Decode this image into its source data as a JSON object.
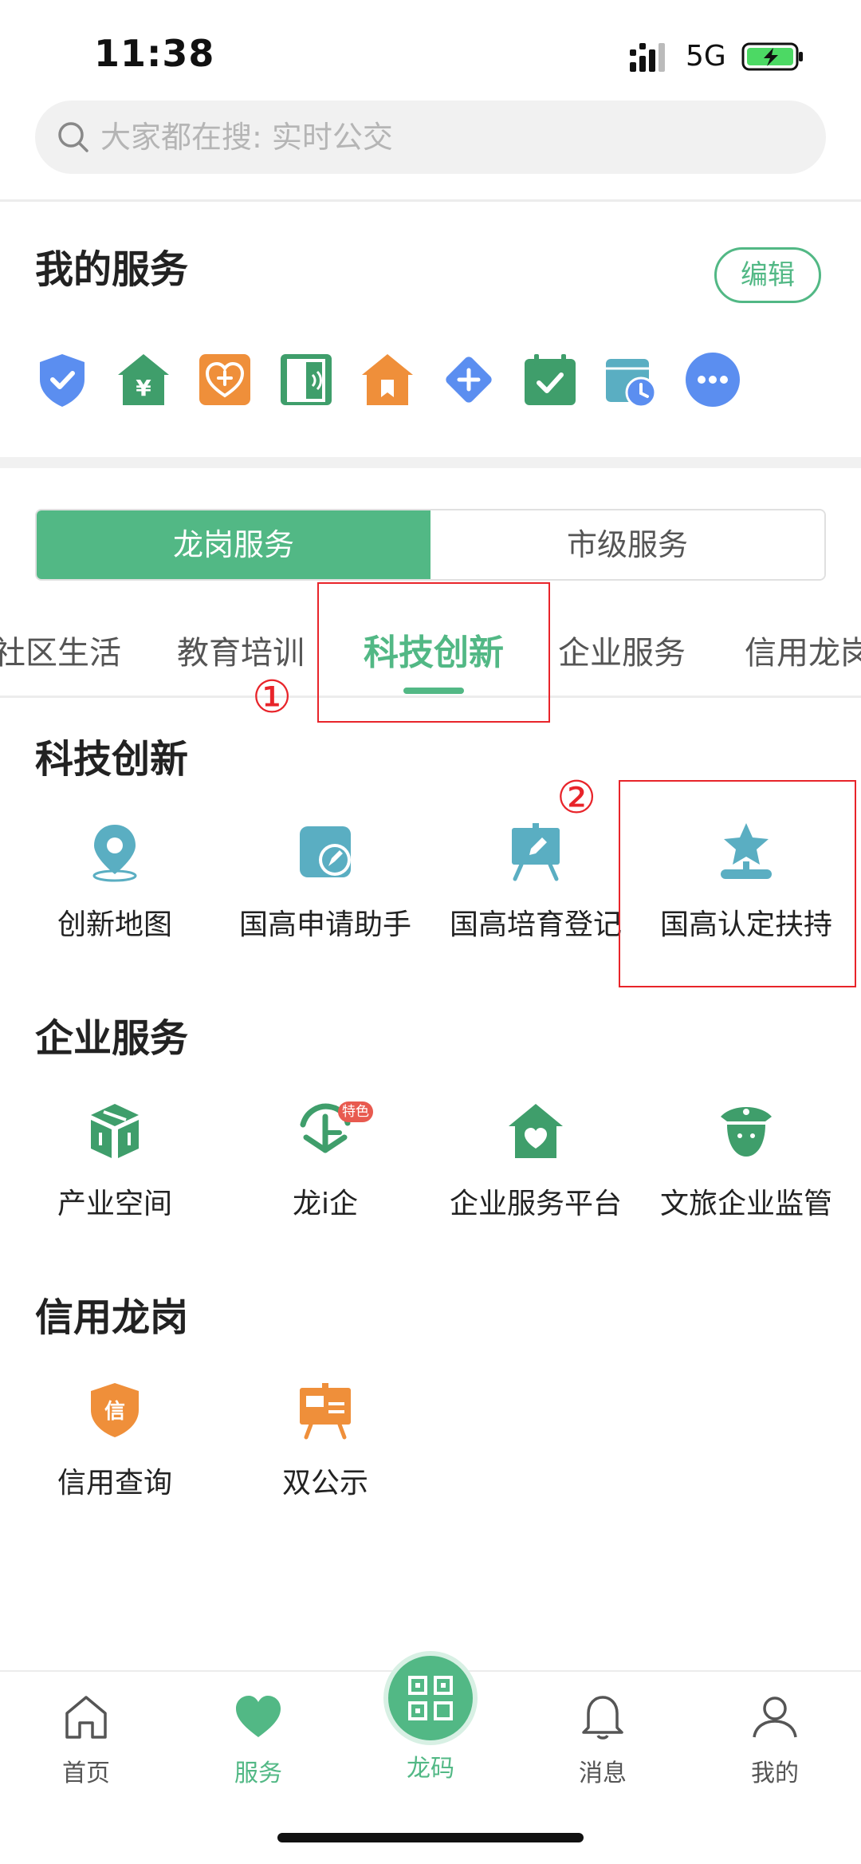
{
  "status_bar": {
    "time": "11:38",
    "network": "5G"
  },
  "search": {
    "placeholder": "大家都在搜: 实时公交"
  },
  "my_services": {
    "title": "我的服务",
    "edit_label": "编辑",
    "icons": [
      "shield-check-icon",
      "money-house-icon",
      "heart-plus-icon",
      "door-icon",
      "bookmark-house-icon",
      "diamond-plus-icon",
      "calendar-check-icon",
      "calendar-clock-icon",
      "more-icon"
    ]
  },
  "segment": {
    "active": "龙岗服务",
    "inactive": "市级服务"
  },
  "category_tabs": [
    "社区生活",
    "教育培训",
    "科技创新",
    "企业服务",
    "信用龙岗"
  ],
  "annotations": {
    "first": "①",
    "second": "②"
  },
  "sections": {
    "tech": {
      "title": "科技创新",
      "items": [
        "创新地图",
        "国高申请助手",
        "国高培育登记",
        "国高认定扶持"
      ]
    },
    "enterprise": {
      "title": "企业服务",
      "items": [
        "产业空间",
        "龙i企",
        "企业服务平台",
        "文旅企业监管"
      ],
      "badge": "特色"
    },
    "credit": {
      "title": "信用龙岗",
      "items": [
        "信用查询",
        "双公示"
      ]
    }
  },
  "bottom_nav": {
    "home": "首页",
    "services": "服务",
    "code": "龙码",
    "messages": "消息",
    "mine": "我的"
  },
  "colors": {
    "accent": "#52b885",
    "orange": "#ef8f3a",
    "blue": "#5b8ef0",
    "teal": "#5aaec2",
    "annotation": "#e8242a"
  }
}
